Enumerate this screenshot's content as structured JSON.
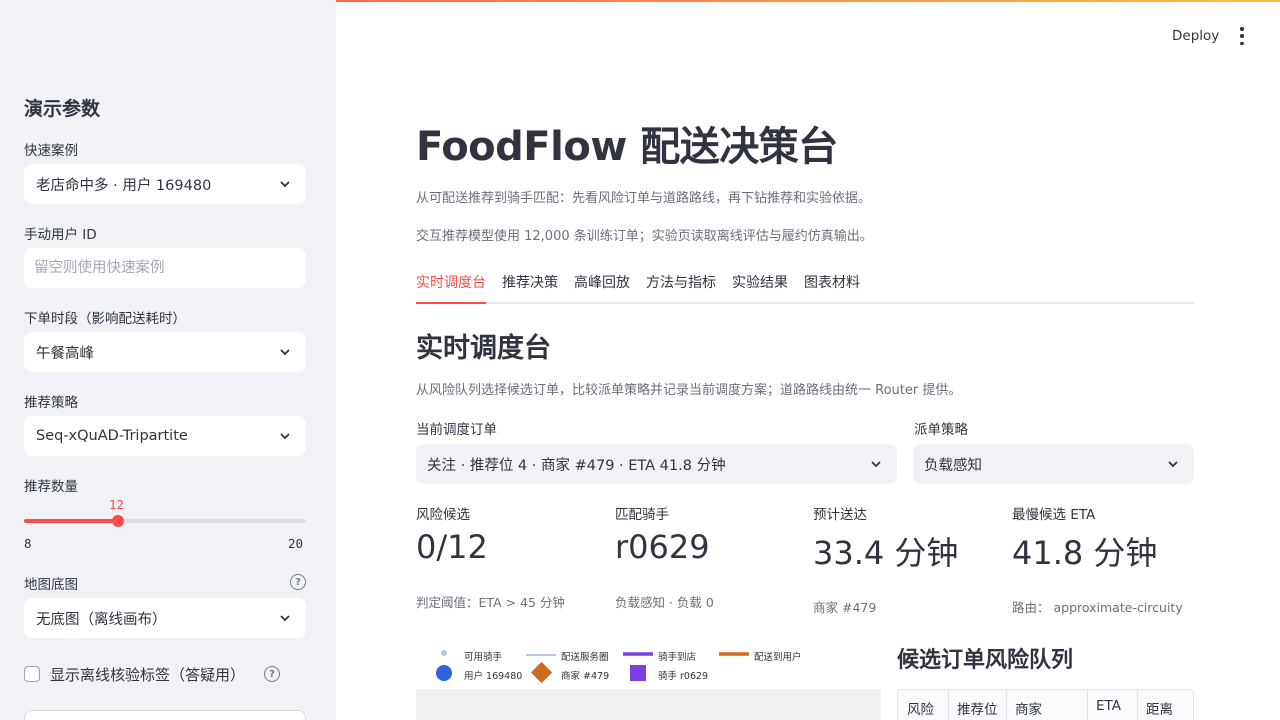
{
  "colors": {
    "accent": "#ff4b4b",
    "sidebar_bg": "#f0f2f6",
    "text": "#31333f",
    "muted": "#6b6f7b",
    "legend_rider": "#a9c8e8",
    "legend_service": "#9db2ea",
    "legend_to_store": "#7b3fe4",
    "legend_to_user": "#d2691e",
    "legend_user": "#2f63e0",
    "legend_store": "#d2691e",
    "legend_rider_marker": "#7b3fe4"
  },
  "sidebar": {
    "title": "演示参数",
    "quick_case": {
      "label": "快速案例",
      "value": "老店命中多 · 用户 169480"
    },
    "manual_user": {
      "label": "手动用户 ID",
      "placeholder": "留空则使用快速案例"
    },
    "order_time": {
      "label": "下单时段（影响配送耗时）",
      "value": "午餐高峰"
    },
    "strategy": {
      "label": "推荐策略",
      "value": "Seq-xQuAD-Tripartite"
    },
    "rec_count": {
      "label": "推荐数量",
      "value": 12,
      "min": 8,
      "max": 20,
      "value_text": "12",
      "min_text": "8",
      "max_text": "20"
    },
    "basemap": {
      "label": "地图底图",
      "value": "无底图（离线画布）",
      "help_icon": "question-circle-icon"
    },
    "offline_check": {
      "label": "显示离线核验标签（答疑用）",
      "checked": false,
      "help_icon": "question-circle-icon"
    }
  },
  "header": {
    "deploy_label": "Deploy",
    "menu_icon": "vertical-dots-icon"
  },
  "main": {
    "title": "FoodFlow 配送决策台",
    "caption1": "从可配送推荐到骑手匹配：先看风险订单与道路路线，再下钻推荐和实验依据。",
    "caption2": "交互推荐模型使用 12,000 条训练订单；实验页读取离线评估与履约仿真输出。",
    "tabs": [
      {
        "label": "实时调度台",
        "active": true
      },
      {
        "label": "推荐决策",
        "active": false
      },
      {
        "label": "高峰回放",
        "active": false
      },
      {
        "label": "方法与指标",
        "active": false
      },
      {
        "label": "实验结果",
        "active": false
      },
      {
        "label": "图表材料",
        "active": false
      }
    ],
    "section_title": "实时调度台",
    "section_caption": "从风险队列选择候选订单，比较派单策略并记录当前调度方案；道路路线由统一 Router 提供。",
    "current_order": {
      "label": "当前调度订单",
      "value": "关注 · 推荐位 4 · 商家 #479 · ETA 41.8 分钟"
    },
    "dispatch_strategy": {
      "label": "派单策略",
      "value": "负载感知"
    },
    "metrics": [
      {
        "label": "风险候选",
        "value": "0/12",
        "delta": "判定阈值：ETA > 45 分钟"
      },
      {
        "label": "匹配骑手",
        "value": "r0629",
        "delta": "负载感知 · 负载 0"
      },
      {
        "label": "预计送达",
        "value": "33.4 分钟",
        "delta": "商家 #479"
      },
      {
        "label": "最慢候选 ETA",
        "value": "41.8 分钟",
        "delta": "路由： approximate-circuity"
      }
    ],
    "legend": {
      "available_rider": "可用骑手",
      "service_circle": "配送服务圈",
      "rider_to_store": "骑手到店",
      "deliver_to_user": "配送到用户",
      "user": "用户 169480",
      "store": "商家 #479",
      "rider": "骑手 r0629"
    },
    "queue": {
      "title": "候选订单风险队列",
      "columns": [
        "风险",
        "推荐位",
        "商家",
        "ETA",
        "距离km"
      ]
    }
  }
}
